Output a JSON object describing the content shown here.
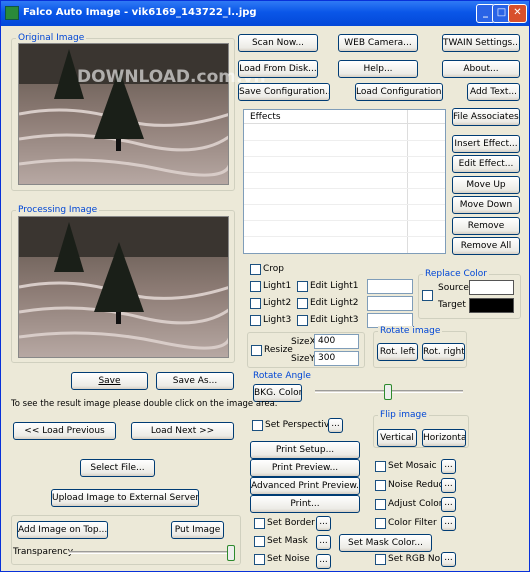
{
  "window": {
    "title": "Falco Auto Image - vik6169_143722_l..jpg"
  },
  "watermark": "DOWNLOAD.com.vn",
  "original_label": "Original Image",
  "processing_label": "Processing Image",
  "buttons": {
    "scan": "Scan Now...",
    "webcam": "WEB Camera...",
    "twain": "TWAIN Settings...",
    "load_disk": "Load From Disk...",
    "help": "Help...",
    "about": "About...",
    "save_conf": "Save Configuration...",
    "load_conf": "Load Configuration...",
    "add_text": "Add Text...",
    "file_assoc": "File Associates...",
    "insert_effect": "Insert Effect...",
    "edit_effect": "Edit Effect...",
    "move_up": "Move Up",
    "move_down": "Move Down",
    "remove": "Remove",
    "remove_all": "Remove All",
    "save": "Save",
    "save_as": "Save As...",
    "load_prev": "<< Load Previous",
    "load_next": "Load Next >>",
    "select_file": "Select File...",
    "upload": "Upload Image to External Server....",
    "add_on_top": "Add Image on Top...",
    "put_image": "Put Image",
    "print_setup": "Print Setup...",
    "print_preview": "Print Preview...",
    "adv_print_preview": "Advanced Print Preview...",
    "print": "Print...",
    "rot_left": "Rot. left",
    "rot_right": "Rot. right",
    "vertical": "Vertical",
    "horizontal": "Horizontal",
    "bkg_color": "BKG. Color",
    "set_mask_color": "Set Mask Color...",
    "dots": "..."
  },
  "effects_header": "Effects",
  "checks": {
    "crop": "Crop",
    "light1": "Light1",
    "light2": "Light2",
    "light3": "Light3",
    "edit_light1": "Edit Light1",
    "edit_light2": "Edit Light2",
    "edit_light3": "Edit Light3",
    "resize": "Resize",
    "perspective": "Set Perspective",
    "mosaic": "Set Mosaic",
    "noise_reduce": "Noise Reduce",
    "adjust_color": "Adjust Color",
    "color_filter": "Color Filter",
    "border": "Set Border",
    "mask": "Set Mask",
    "noise": "Set Noise",
    "rgb_noise": "Set RGB Noise"
  },
  "replace_color": {
    "title": "Replace Color",
    "source": "Source",
    "target": "Target",
    "source_color": "#ffffff",
    "target_color": "#000000"
  },
  "resize": {
    "sizex_label": "SizeX",
    "sizey_label": "SizeY",
    "sizex": "400",
    "sizey": "300"
  },
  "rotate_image": "Rotate image",
  "rotate_angle": "Rotate Angle",
  "flip_image": "Flip image",
  "hint": "To see the result image please double click on the image area.",
  "transparency": "Transparency"
}
